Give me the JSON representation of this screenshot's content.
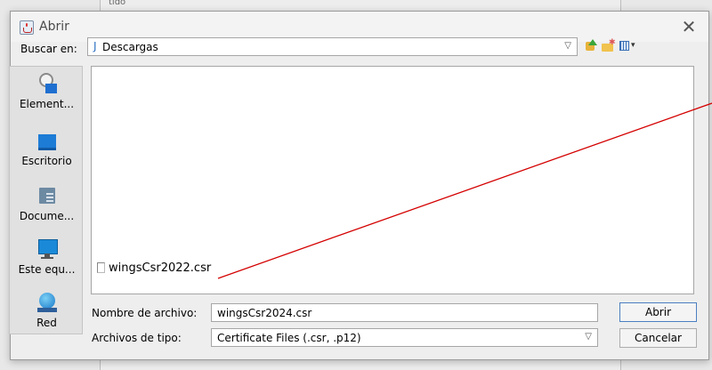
{
  "background": {
    "text": "tido"
  },
  "dialog": {
    "title": "Abrir",
    "close_glyph": "✕",
    "look_in": {
      "label": "Buscar en:",
      "value": "Descargas",
      "folder_glyph": "J"
    },
    "toolbar": {
      "up_icon": "up-folder-icon",
      "new_folder_icon": "new-folder-icon",
      "view_icon": "view-menu-icon"
    },
    "places": [
      {
        "label": "Element...",
        "icon": "recent-items-icon"
      },
      {
        "label": "Escritorio",
        "icon": "desktop-icon"
      },
      {
        "label": "Docume...",
        "icon": "documents-icon"
      },
      {
        "label": "Este equ...",
        "icon": "this-pc-icon"
      },
      {
        "label": "Red",
        "icon": "network-icon"
      }
    ],
    "files": [
      {
        "name": "wingsCsr2022.csr"
      }
    ],
    "filename": {
      "label": "Nombre de archivo:",
      "value": "wingsCsr2024.csr"
    },
    "filetype": {
      "label": "Archivos de tipo:",
      "value": "Certificate Files (.csr, .p12)"
    },
    "buttons": {
      "open": "Abrir",
      "cancel": "Cancelar"
    },
    "annotation_color": "#d40000"
  }
}
